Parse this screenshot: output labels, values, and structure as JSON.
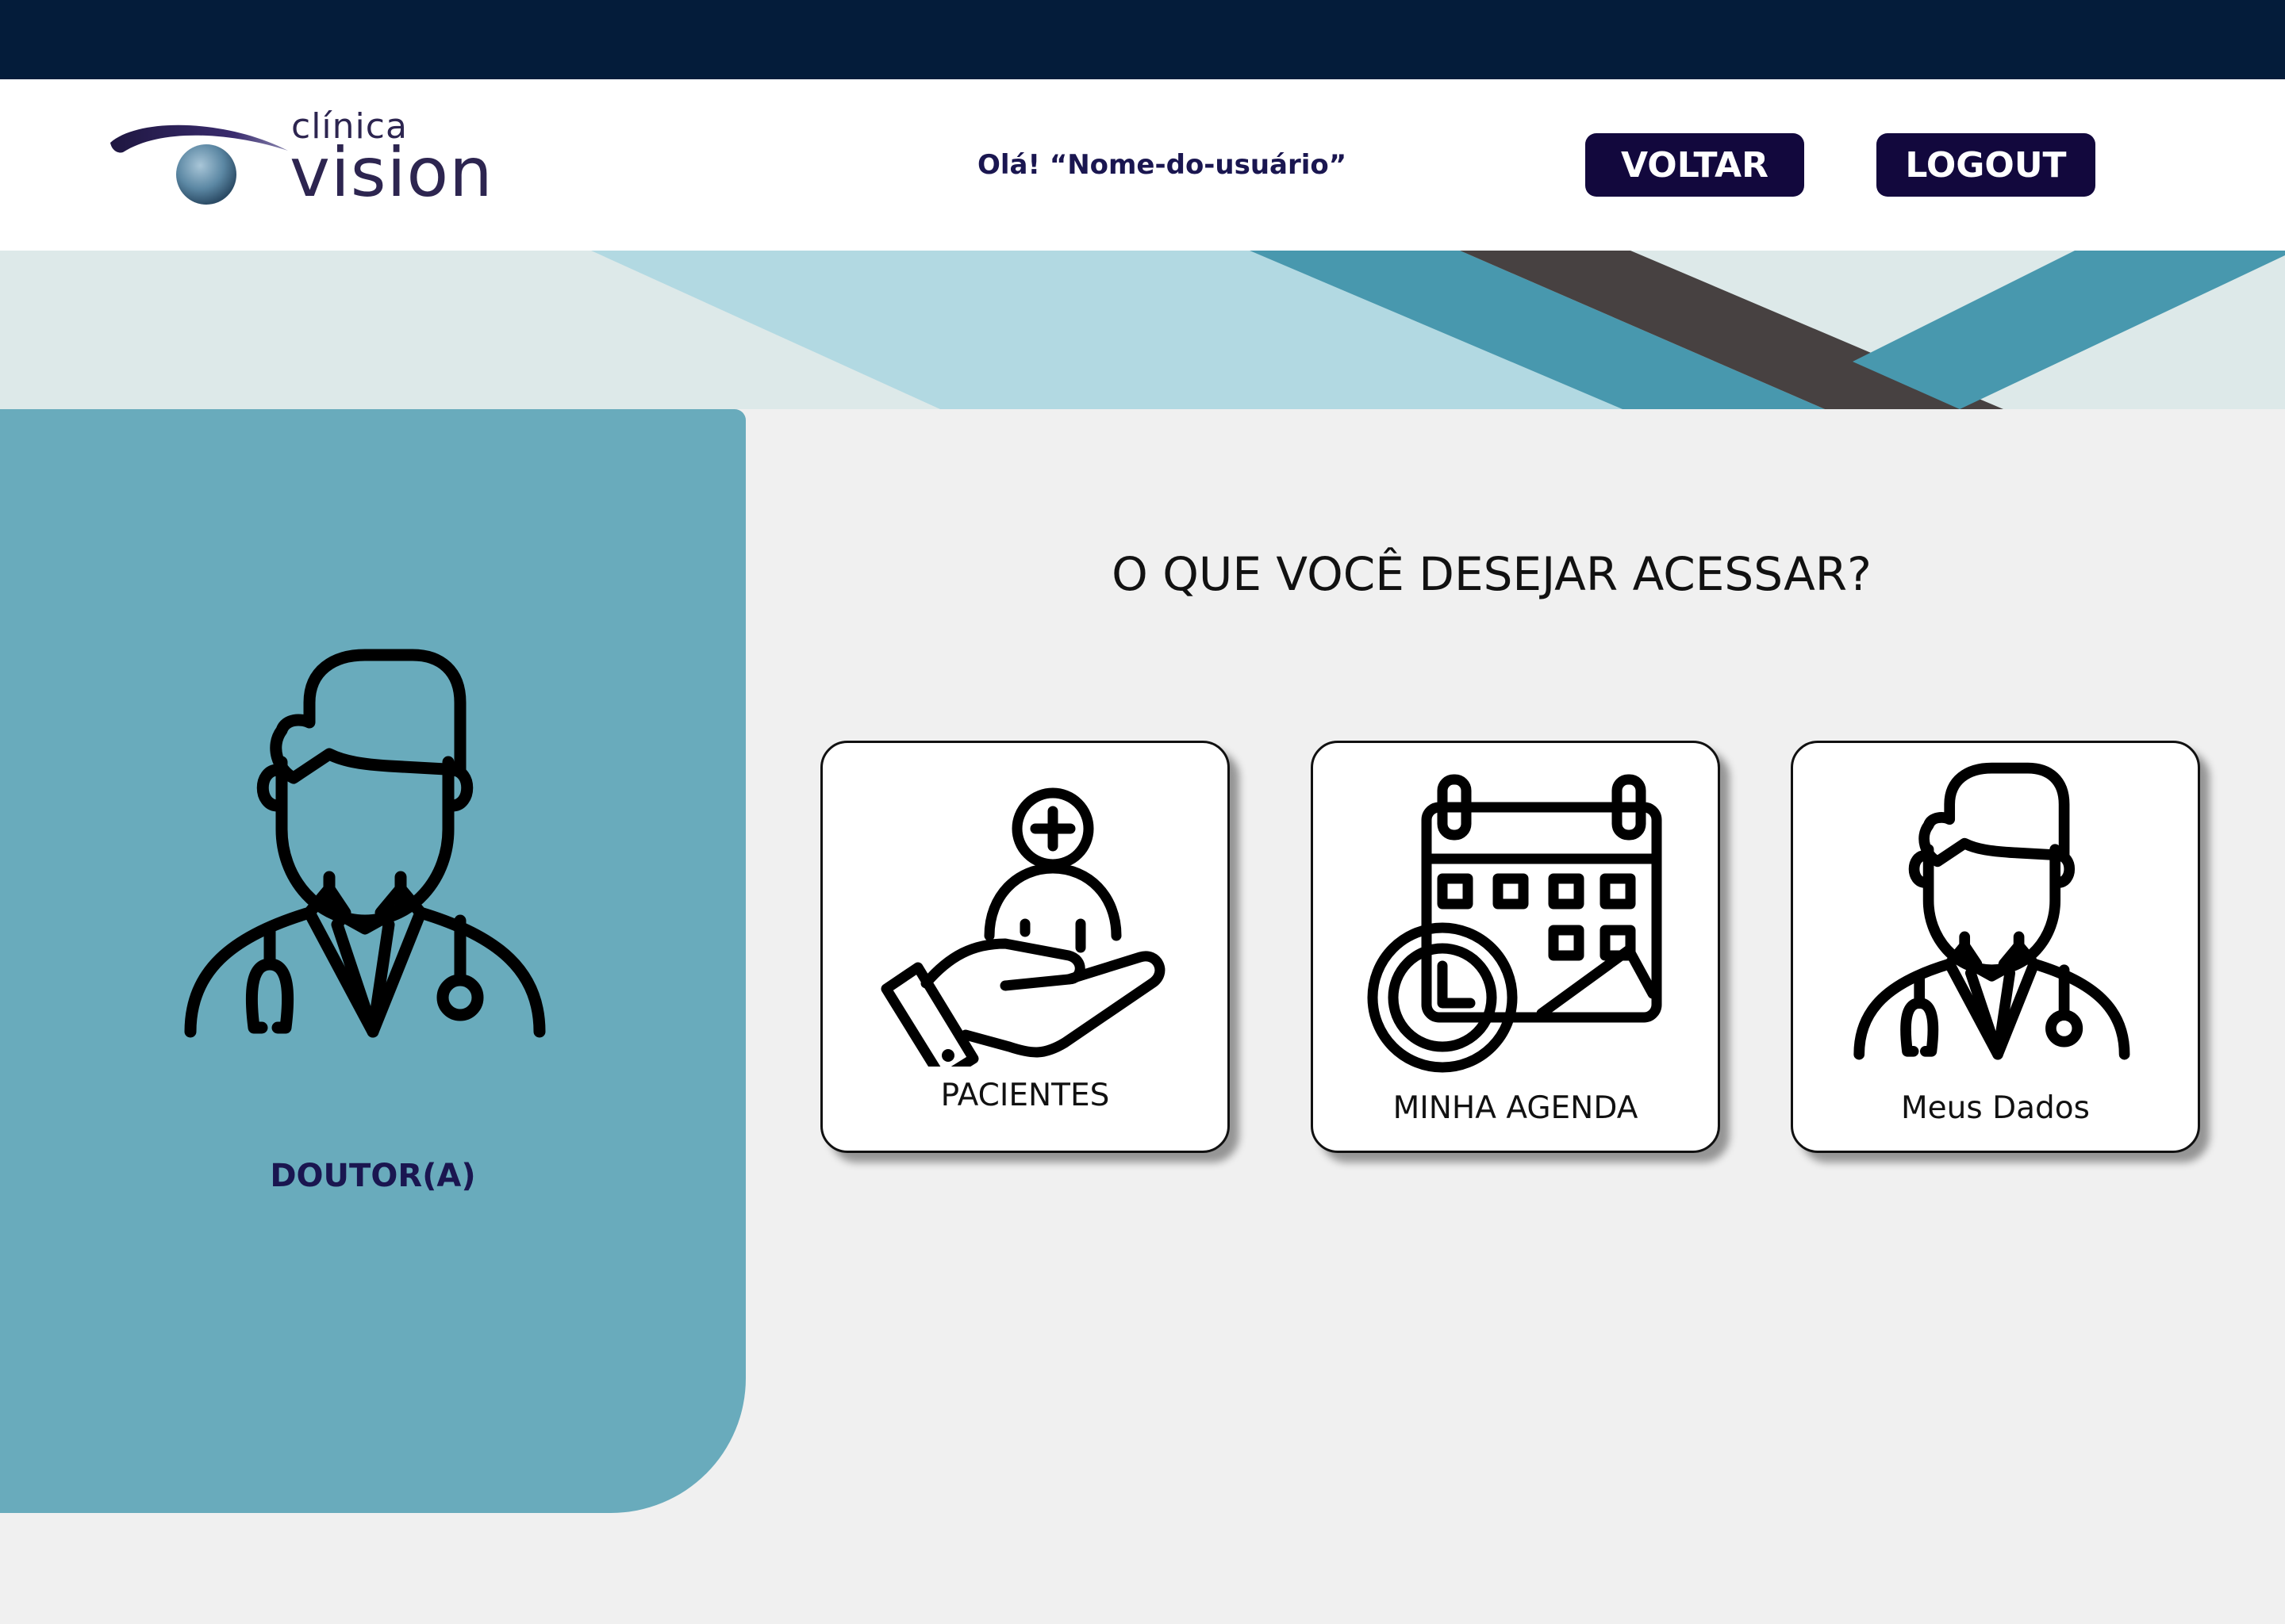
{
  "colors": {
    "top_bar": "#041c3a",
    "header_bg": "#ffffff",
    "button_bg": "#12083d",
    "side_panel": "#69abbc",
    "page_bg": "#f0f0f0",
    "brand_text": "#2d2550"
  },
  "logo": {
    "small_text": "clínica",
    "big_text": "vision",
    "icon": "eye-logo-icon"
  },
  "header": {
    "greeting": "Olá! “Nome-do-usuário”",
    "back_button": "VOLTAR",
    "logout_button": "LOGOUT"
  },
  "sidebar": {
    "role_label": "DOUTOR(A)",
    "icon": "doctor-icon"
  },
  "main": {
    "question": "O QUE VOCÊ DESEJAR ACESSAR?",
    "cards": [
      {
        "label": "PACIENTES",
        "icon": "patient-care-icon"
      },
      {
        "label": "MINHA AGENDA",
        "icon": "calendar-clock-icon"
      },
      {
        "label": "Meus Dados",
        "icon": "doctor-icon"
      }
    ]
  }
}
